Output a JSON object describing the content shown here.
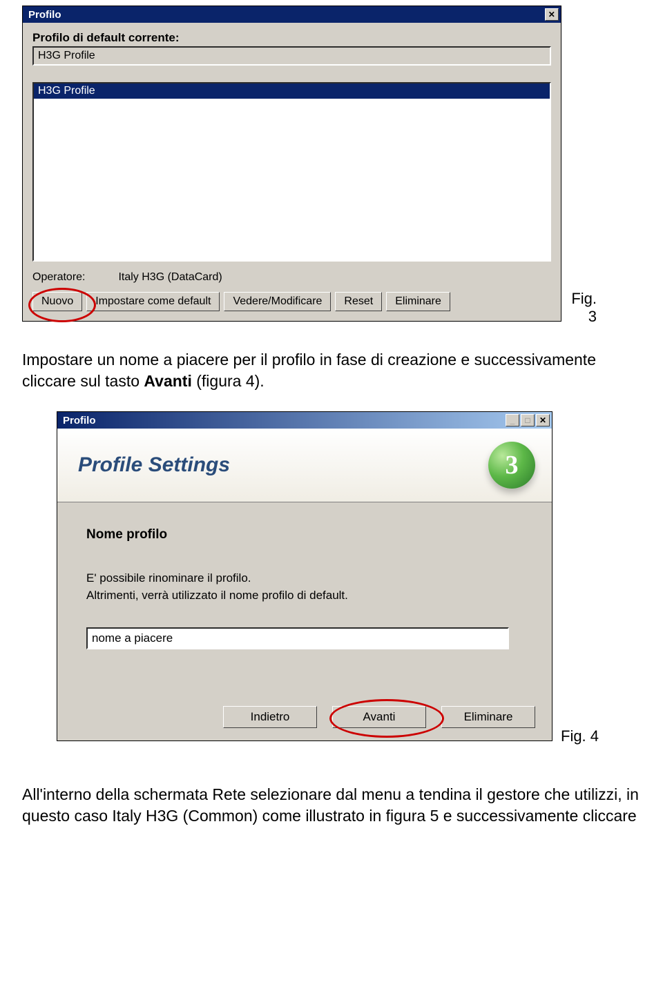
{
  "fig3": {
    "title": "Profilo",
    "default_label": "Profilo di default corrente:",
    "default_value": "H3G Profile",
    "list_selected": "H3G Profile",
    "operator_label": "Operatore:",
    "operator_value": "Italy H3G (DataCard)",
    "buttons": {
      "nuovo": "Nuovo",
      "default": "Impostare come default",
      "view": "Vedere/Modificare",
      "reset": "Reset",
      "delete": "Eliminare"
    },
    "caption": "Fig. 3"
  },
  "para1": {
    "pre": "Impostare un nome a piacere per il profilo in fase di creazione e successivamente cliccare sul tasto ",
    "bold": "Avanti",
    "post": " (figura 4)."
  },
  "fig4": {
    "title": "Profilo",
    "heading": "Profile Settings",
    "logo_text": "3",
    "subtitle": "Nome profilo",
    "desc_line1": "E' possibile rinominare il profilo.",
    "desc_line2": "Altrimenti, verrà utilizzato il nome profilo di default.",
    "input_value": "nome a piacere",
    "buttons": {
      "back": "Indietro",
      "next": "Avanti",
      "delete": "Eliminare"
    },
    "caption": "Fig. 4"
  },
  "para2": {
    "pre": "All'interno della schermata ",
    "bold1": "Rete",
    "mid": " selezionare dal menu a tendina il gestore che utilizzi, in questo caso Italy H3G (Common)  come illustrato in figura 5 e successivamente cliccare"
  }
}
